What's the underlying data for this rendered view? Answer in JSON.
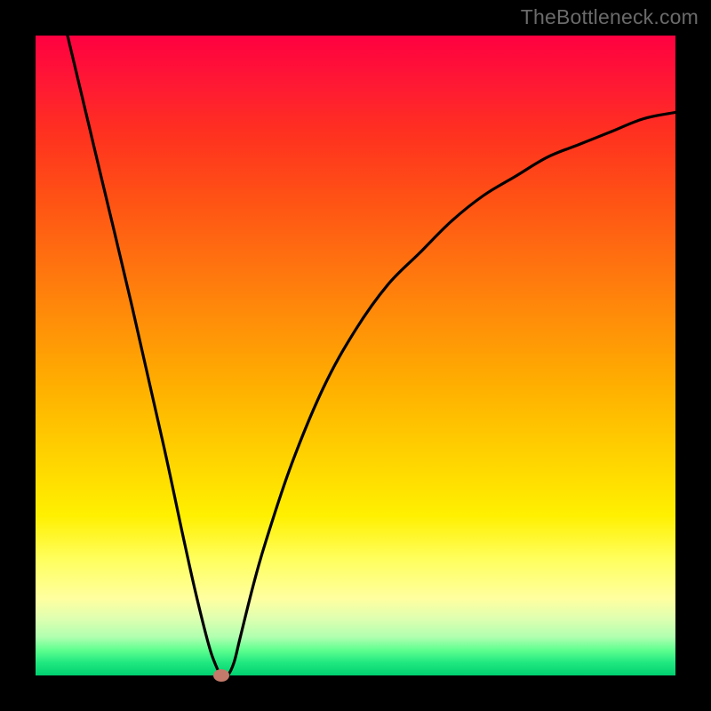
{
  "attribution": "TheBottleneck.com",
  "chart_data": {
    "type": "line",
    "title": "",
    "xlabel": "",
    "ylabel": "",
    "xlim": [
      0,
      100
    ],
    "ylim": [
      0,
      100
    ],
    "series": [
      {
        "name": "bottleneck-curve",
        "x": [
          5,
          10,
          15,
          20,
          23,
          25,
          27,
          28,
          29,
          30,
          31,
          32,
          34,
          36,
          40,
          45,
          50,
          55,
          60,
          65,
          70,
          75,
          80,
          85,
          90,
          95,
          100
        ],
        "y": [
          100,
          79,
          58,
          36,
          22,
          13,
          5,
          2,
          0,
          0,
          2,
          6,
          14,
          21,
          33,
          45,
          54,
          61,
          66,
          71,
          75,
          78,
          81,
          83,
          85,
          87,
          88
        ]
      }
    ],
    "marker": {
      "x": 29,
      "y": 0,
      "color": "#c47a6a"
    },
    "gradient_stops": [
      {
        "pos": 0,
        "color": "#ff0040"
      },
      {
        "pos": 50,
        "color": "#ffc000"
      },
      {
        "pos": 85,
        "color": "#ffff80"
      },
      {
        "pos": 100,
        "color": "#00d070"
      }
    ]
  }
}
